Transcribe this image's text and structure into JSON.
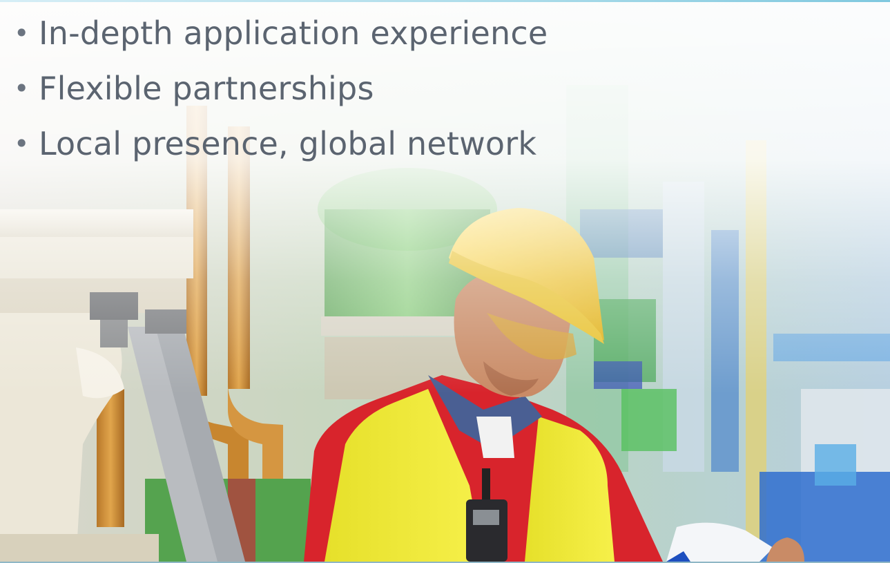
{
  "slide": {
    "bullets": [
      {
        "text": "In-depth application experience"
      },
      {
        "text": "Flexible partnerships"
      },
      {
        "text": "Local presence, global network"
      }
    ],
    "bullet_glyph": "•",
    "photo": "industrial-plant-worker-image",
    "colors": {
      "bullet_text": "#5b6470",
      "top_rule": "#7fc8df",
      "bottom_rule": "#8fb7c6"
    }
  }
}
